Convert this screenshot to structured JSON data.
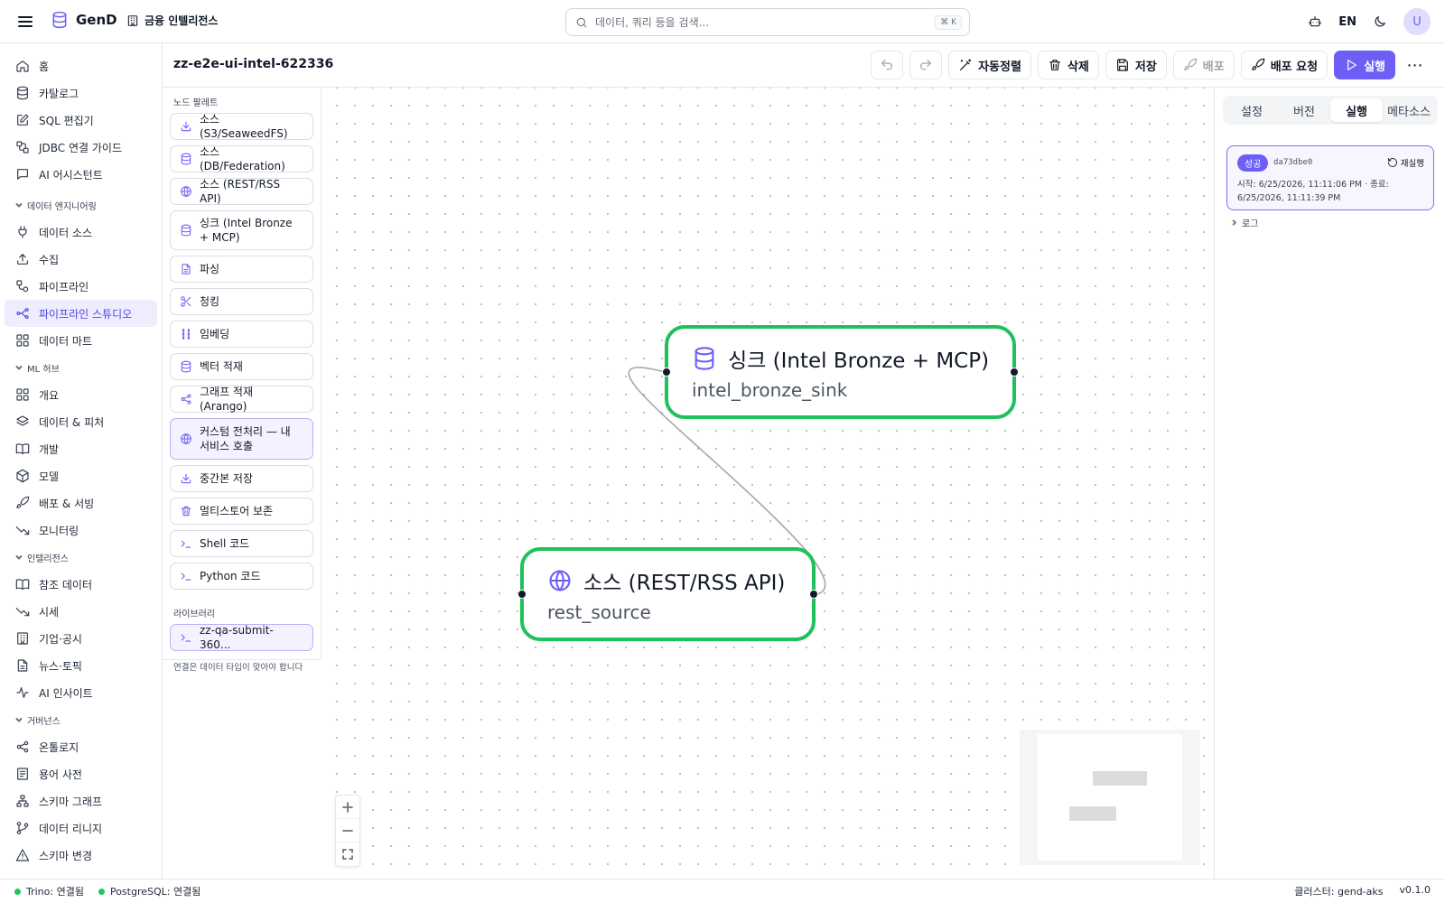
{
  "app": {
    "name": "GenD",
    "workspace": "금융 인텔리전스"
  },
  "search": {
    "placeholder": "데이터, 쿼리 등을 검색...",
    "shortcut": "⌘ K"
  },
  "header_right": {
    "lang": "EN",
    "avatar": "U"
  },
  "nav": {
    "top": [
      {
        "label": "홈",
        "icon": "home-icon"
      },
      {
        "label": "카탈로그",
        "icon": "database-icon"
      },
      {
        "label": "SQL 편집기",
        "icon": "edit-icon"
      },
      {
        "label": "JDBC 연결 가이드",
        "icon": "link-icon"
      },
      {
        "label": "AI 어시스턴트",
        "icon": "message-icon"
      }
    ],
    "sections": [
      {
        "title": "데이터 엔지니어링",
        "items": [
          {
            "label": "데이터 소스",
            "icon": "plug-icon"
          },
          {
            "label": "수집",
            "icon": "upload-icon"
          },
          {
            "label": "파이프라인",
            "icon": "workflow-icon"
          },
          {
            "label": "파이프라인 스튜디오",
            "icon": "studio-icon",
            "active": true
          },
          {
            "label": "데이터 마트",
            "icon": "grid-icon"
          }
        ]
      },
      {
        "title": "ML 허브",
        "items": [
          {
            "label": "개요",
            "icon": "grid-icon"
          },
          {
            "label": "데이터 & 피처",
            "icon": "layers-icon"
          },
          {
            "label": "개발",
            "icon": "book-icon"
          },
          {
            "label": "모델",
            "icon": "cube-icon"
          },
          {
            "label": "배포 & 서빙",
            "icon": "rocket-icon"
          },
          {
            "label": "모니터링",
            "icon": "trend-icon"
          }
        ]
      },
      {
        "title": "인텔리전스",
        "items": [
          {
            "label": "참조 데이터",
            "icon": "book-icon"
          },
          {
            "label": "시세",
            "icon": "trend-icon"
          },
          {
            "label": "기업·공시",
            "icon": "building-icon"
          },
          {
            "label": "뉴스·토픽",
            "icon": "file-icon"
          },
          {
            "label": "AI 인사이트",
            "icon": "activity-icon"
          }
        ]
      },
      {
        "title": "거버넌스",
        "items": [
          {
            "label": "온톨로지",
            "icon": "share-icon"
          },
          {
            "label": "용어 사전",
            "icon": "list-icon"
          },
          {
            "label": "스키마 그래프",
            "icon": "sitemap-icon"
          },
          {
            "label": "데이터 리니지",
            "icon": "branch-icon"
          },
          {
            "label": "스키마 변경",
            "icon": "warning-icon"
          }
        ]
      }
    ]
  },
  "editor": {
    "title": "zz-e2e-ui-intel-622336",
    "buttons": {
      "autolayout": "자동정렬",
      "delete": "삭제",
      "save": "저장",
      "deploy": "배포",
      "deploy_request": "배포 요청",
      "run": "실행"
    }
  },
  "palette": {
    "title": "노드 팔레트",
    "items": [
      {
        "label": "소스 (S3/SeaweedFS)",
        "icon": "download-icon"
      },
      {
        "label": "소스 (DB/Federation)",
        "icon": "database-icon"
      },
      {
        "label": "소스 (REST/RSS API)",
        "icon": "globe-icon"
      },
      {
        "label": "싱크 (Intel Bronze + MCP)",
        "icon": "database-icon"
      },
      {
        "label": "파싱",
        "icon": "file-icon"
      },
      {
        "label": "청킹",
        "icon": "scissors-icon"
      },
      {
        "label": "임베딩",
        "icon": "embed-icon"
      },
      {
        "label": "벡터 적재",
        "icon": "database-icon"
      },
      {
        "label": "그래프 적재 (Arango)",
        "icon": "share-icon"
      },
      {
        "label": "커스텀 전처리 — 내 서비스 호출",
        "icon": "globe-icon"
      },
      {
        "label": "중간본 저장",
        "icon": "download-icon"
      },
      {
        "label": "멀티스토어 보존",
        "icon": "trash-icon"
      },
      {
        "label": "Shell 코드",
        "icon": "terminal-icon"
      },
      {
        "label": "Python 코드",
        "icon": "terminal-icon"
      }
    ],
    "library_title": "라이브러리",
    "library_items": [
      {
        "label": "zz-qa-submit-360...",
        "icon": "terminal-icon"
      }
    ],
    "note": "연결은 데이터 타입이 맞아야 합니다"
  },
  "canvas": {
    "nodes": [
      {
        "title": "싱크 (Intel Bronze + MCP)",
        "name": "intel_bronze_sink",
        "icon": "database-icon",
        "status_color": "#1fc15b"
      },
      {
        "title": "소스 (REST/RSS API)",
        "name": "rest_source",
        "icon": "globe-icon",
        "status_color": "#1fc15b"
      }
    ],
    "edges": [
      {
        "from": "rest_source",
        "to": "intel_bronze_sink"
      }
    ]
  },
  "right_panel": {
    "tabs": [
      "설정",
      "버전",
      "실행",
      "메타소스"
    ],
    "active_tab": "실행",
    "run": {
      "status": "성공",
      "id": "da73dbe0",
      "rerun": "재실행",
      "time": "시작: 6/25/2026, 11:11:06 PM · 종료: 6/25/2026, 11:11:39 PM"
    },
    "log_label": "로그"
  },
  "statusbar": {
    "trino": "Trino: 연결됨",
    "postgres": "PostgreSQL: 연결됨",
    "cluster": "클러스터: gend-aks",
    "version": "v0.1.0"
  },
  "colors": {
    "accent": "#6d5ff5",
    "success": "#1fc15b",
    "status_dot": "#22c55e"
  }
}
